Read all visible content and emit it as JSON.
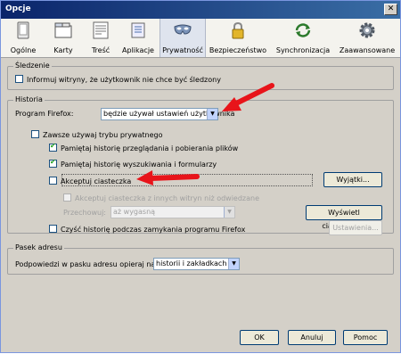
{
  "window": {
    "title": "Opcje",
    "close_label": "✕"
  },
  "toolbar": {
    "items": [
      {
        "label": "Ogólne",
        "icon": "general-icon"
      },
      {
        "label": "Karty",
        "icon": "tabs-icon"
      },
      {
        "label": "Treść",
        "icon": "content-icon"
      },
      {
        "label": "Aplikacje",
        "icon": "applications-icon"
      },
      {
        "label": "Prywatność",
        "icon": "privacy-mask-icon",
        "active": true
      },
      {
        "label": "Bezpieczeństwo",
        "icon": "security-lock-icon"
      },
      {
        "label": "Synchronizacja",
        "icon": "sync-icon"
      },
      {
        "label": "Zaawansowane",
        "icon": "gear-icon"
      }
    ]
  },
  "sledzenie": {
    "title": "Śledzenie",
    "dnt_label": "Informuj witryny, że użytkownik nie chce być śledzony"
  },
  "historia": {
    "title": "Historia",
    "program_label": "Program Firefox:",
    "program_value": "będzie używał ustawień użytkownika",
    "always_private": "Zawsze używaj trybu prywatnego",
    "remember_browsing": "Pamiętaj historię przeglądania i pobierania plików",
    "remember_search": "Pamiętaj historię wyszukiwania i formularzy",
    "accept_cookies": "Akceptuj ciasteczka",
    "exceptions_button": "Wyjątki...",
    "third_party": "Akceptuj ciasteczka z innych witryn niż odwiedzane",
    "keep_label": "Przechowuj:",
    "keep_value": "aż wygasną",
    "show_cookies_button": "Wyświetl ciasteczka...",
    "clear_on_close": "Czyść historię podczas zamykania programu Firefox",
    "settings_button": "Ustawienia..."
  },
  "pasek": {
    "title": "Pasek adresu",
    "suggest_label": "Podpowiedzi w pasku adresu opieraj na:",
    "suggest_value": "historii i zakładkach"
  },
  "footer": {
    "ok": "OK",
    "cancel": "Anuluj",
    "help": "Pomoc"
  },
  "colors": {
    "arrow": "#e8141a",
    "title_bar": "#0a246a",
    "active_tab": "#dfe4ee"
  }
}
